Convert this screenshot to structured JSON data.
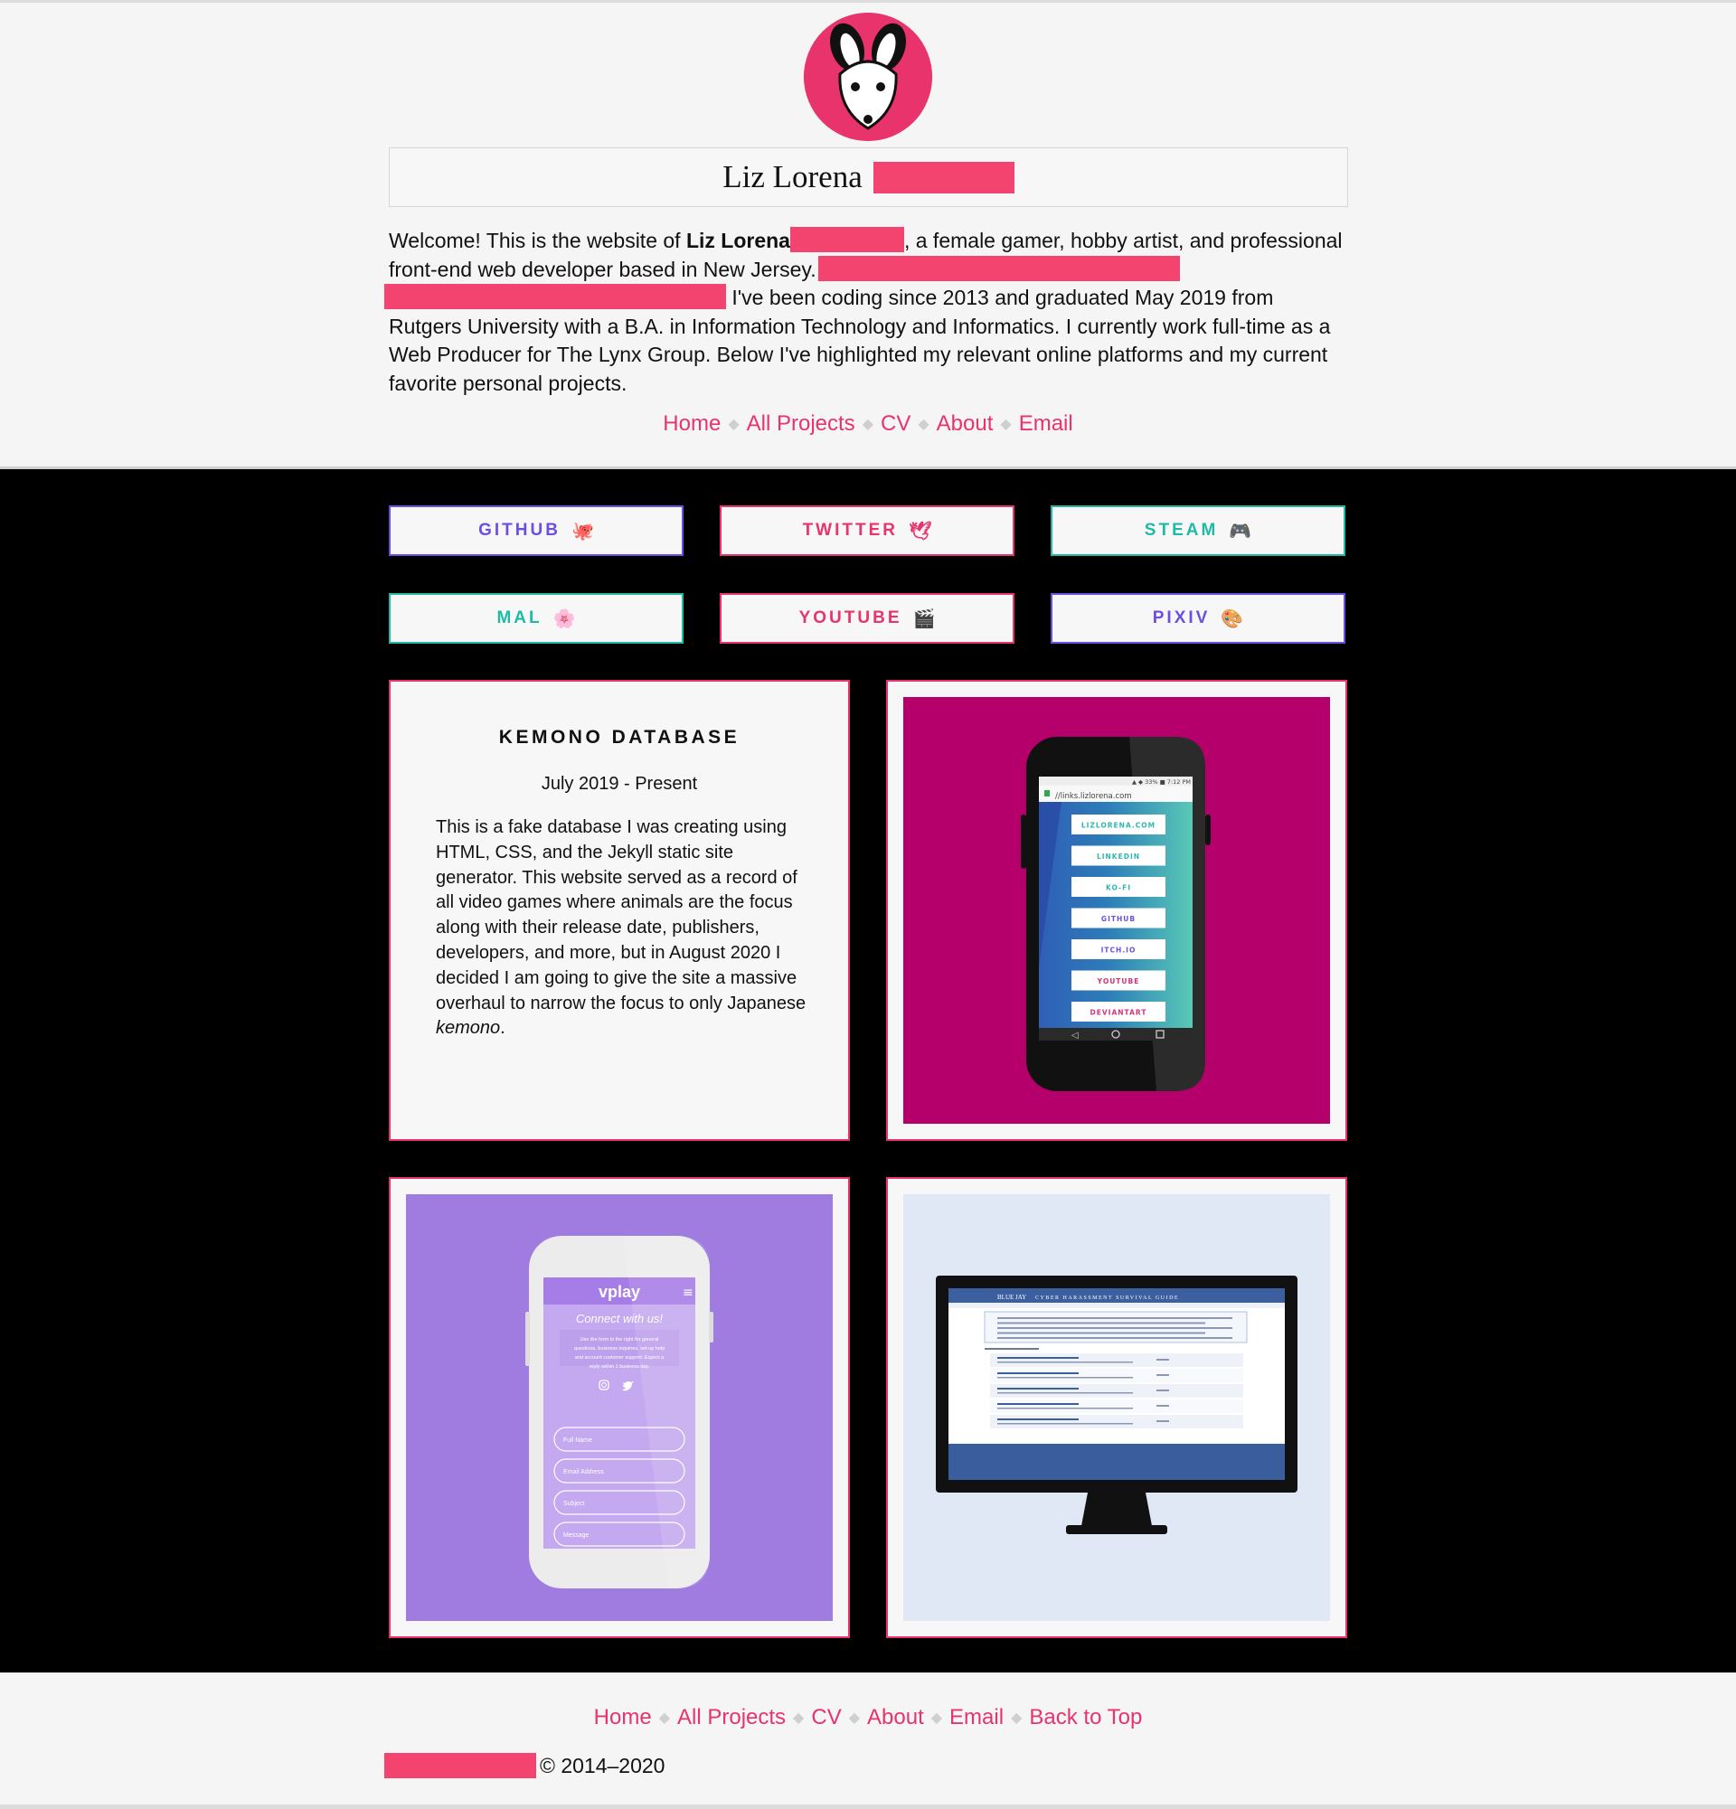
{
  "header": {
    "avatar_alt": "white mouse logo",
    "name": "Liz Lorena",
    "intro": {
      "welcome": "Welcome! This is the website of ",
      "name_bold": "Liz Lorena",
      "after_name": ", a female gamer, hobby artist, and professional front-end web developer based in New Jersey.",
      "after_redaction": " I've been coding since 2013 and graduated May 2019 from Rutgers University with a B.A. in Information Technology and Informatics. I currently work full-time as a Web Producer for The Lynx Group. Below I've highlighted my relevant online platforms and my current favorite personal projects."
    },
    "nav": [
      "Home",
      "All Projects",
      "CV",
      "About",
      "Email"
    ]
  },
  "colors": {
    "accent": "#e8336d",
    "redaction": "#f3436f",
    "purple": "#7b4fe0",
    "teal": "#1fb9a6",
    "pink": "#e8336d"
  },
  "social": [
    {
      "label": "GITHUB",
      "emoji": "🐙",
      "color": "#6c4fe0",
      "border": "#6c4fe0"
    },
    {
      "label": "TWITTER",
      "emoji": "🕊",
      "color": "#e8336d",
      "border": "#e8336d"
    },
    {
      "label": "STEAM",
      "emoji": "🎮",
      "color": "#1fb9a6",
      "border": "#1fb9a6"
    },
    {
      "label": "MAL",
      "emoji": "🌸",
      "color": "#1fb9a6",
      "border": "#1fb9a6"
    },
    {
      "label": "YOUTUBE",
      "emoji": "🎬",
      "color": "#e8336d",
      "border": "#e8336d"
    },
    {
      "label": "PIXIV",
      "emoji": "🎨",
      "color": "#6c4fe0",
      "border": "#6c4fe0"
    }
  ],
  "project": {
    "title": "KEMONO DATABASE",
    "date": "July 2019 - Present",
    "desc_before": "This is a fake database I was creating using HTML, CSS, and the Jekyll static site generator. This website served as a record of all video games where animals are the focus along with their release date, publishers, developers, and more, but in August 2020 I decided I am going to give the site a massive overhaul to narrow the focus to only Japanese ",
    "desc_italic": "kemono",
    "desc_after": "."
  },
  "phone_links": {
    "status": "▲ ◆ 33% ■ 7:12 PM",
    "url": "//links.lizlorena.com",
    "buttons": [
      "LIZLORENA.COM",
      "LINKEDIN",
      "KO-FI",
      "GITHUB",
      "ITCH.IO",
      "YOUTUBE",
      "DEVIANTART"
    ]
  },
  "vplay": {
    "logo": "vplay",
    "heading": "Connect with us!",
    "body": "Use the form to the right for general questions, business inquiries, set-up help and account customer support. Expect a reply within 1 business day.",
    "fields": [
      "Full Name",
      "Email Address",
      "Subject",
      "Message"
    ]
  },
  "bluejay": {
    "title": "BLUE JAY",
    "subtitle": "CYBER HARASSMENT SURVIVAL GUIDE"
  },
  "footer": {
    "nav": [
      "Home",
      "All Projects",
      "CV",
      "About",
      "Email",
      "Back to Top"
    ],
    "copyright": "© 2014–2020"
  }
}
